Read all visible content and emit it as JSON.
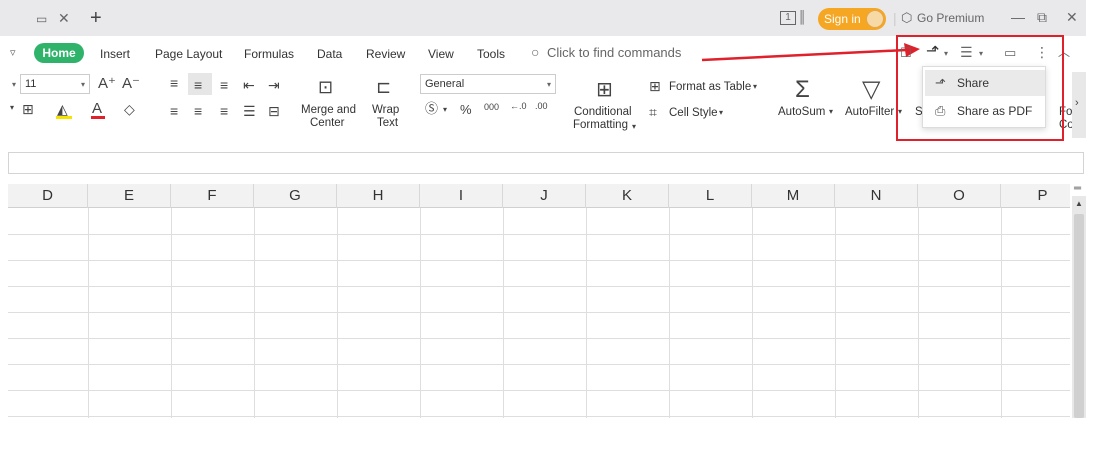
{
  "titlebar": {
    "new_tab": "+",
    "sign_in": "Sign in",
    "go_premium": "Go Premium",
    "page_indicator": "1"
  },
  "menu": {
    "home": "Home",
    "items": [
      "Insert",
      "Page Layout",
      "Formulas",
      "Data",
      "Review",
      "View",
      "Tools"
    ],
    "search_placeholder": "Click to find commands"
  },
  "ribbon": {
    "font_size": "11",
    "number_format": "General",
    "merge_center": [
      "Merge and",
      "Center"
    ],
    "wrap_text": [
      "Wrap",
      "Text"
    ],
    "conditional_formatting": [
      "Conditional",
      "Formatting"
    ],
    "format_as_table": "Format as Table",
    "cell_style": "Cell Style",
    "autosum": "AutoSum",
    "autofilter": "AutoFilter",
    "truncated_s": "S",
    "truncated_fo": "Fo",
    "truncated_co": "Co"
  },
  "share_menu": {
    "items": [
      {
        "label": "Share",
        "icon": "share-icon"
      },
      {
        "label": "Share as PDF",
        "icon": "pdf-icon"
      }
    ]
  },
  "columns": [
    "D",
    "E",
    "F",
    "G",
    "H",
    "I",
    "J",
    "K",
    "L",
    "M",
    "N",
    "O",
    "P"
  ],
  "colors": {
    "accent_green": "#2fb36b",
    "sign_in_orange": "#f5a623",
    "highlight_red": "#e0202a"
  }
}
